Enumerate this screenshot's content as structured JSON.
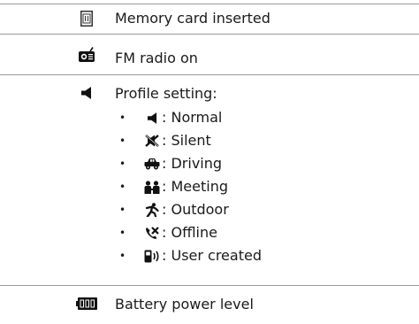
{
  "rows": [
    {
      "icon": "memory-card-icon",
      "label": "Memory card inserted"
    },
    {
      "icon": "fm-radio-icon",
      "label": "FM radio on"
    },
    {
      "icon": "speaker-icon",
      "label": "Profile setting:",
      "profiles": [
        {
          "icon": "speaker-icon",
          "label": ": Normal"
        },
        {
          "icon": "silent-icon",
          "label": ": Silent"
        },
        {
          "icon": "car-icon",
          "label": ": Driving"
        },
        {
          "icon": "meeting-icon",
          "label": ": Meeting"
        },
        {
          "icon": "outdoor-icon",
          "label": ": Outdoor"
        },
        {
          "icon": "offline-icon",
          "label": ": Offline"
        },
        {
          "icon": "user-created-icon",
          "label": ": User created"
        }
      ]
    },
    {
      "icon": "battery-icon",
      "label": "Battery power level"
    }
  ],
  "bullet_char": "•"
}
